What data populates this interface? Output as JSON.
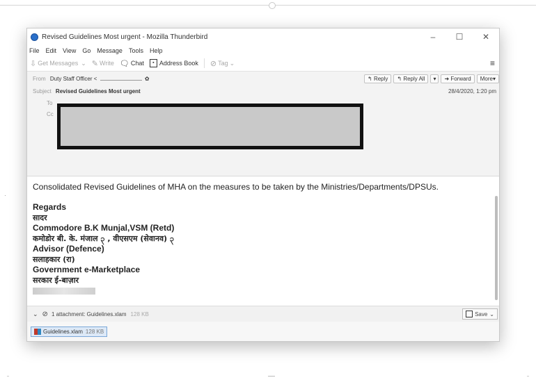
{
  "window": {
    "title": "Revised Guidelines Most urgent - Mozilla Thunderbird",
    "controls": {
      "minimize": "–",
      "maximize": "☐",
      "close": "✕"
    }
  },
  "menu": [
    "File",
    "Edit",
    "View",
    "Go",
    "Message",
    "Tools",
    "Help"
  ],
  "toolbar": {
    "get_messages": "Get Messages",
    "write": "Write",
    "chat": "Chat",
    "address_book": "Address Book",
    "tag": "Tag"
  },
  "header": {
    "from_label": "From",
    "from_value": "Duty Staff Officer <",
    "subject_label": "Subject",
    "subject": "Revised Guidelines Most urgent",
    "to_label": "To",
    "cc_label": "Cc",
    "date": "28/4/2020, 1:20 pm",
    "buttons": {
      "reply": "Reply",
      "reply_all": "Reply All",
      "forward": "Forward",
      "more": "More"
    }
  },
  "body": {
    "intro": "Consolidated Revised Guidelines of MHA on the measures to be taken by the Ministries/Departments/DPSUs.",
    "signature": [
      {
        "text": "Regards",
        "style": "b"
      },
      {
        "text": "सादर",
        "style": "dev"
      },
      {
        "text": "Commodore B.K Munjal,VSM (Retd)",
        "style": "b"
      },
      {
        "text": "कमोडोर बी. के. मंजाल ၃ , वीएसएम (सेवानव) ၃",
        "style": "dev"
      },
      {
        "text": "Advisor (Defence)",
        "style": "b"
      },
      {
        "text": "सलाहकार (रा)",
        "style": "dev"
      },
      {
        "text": "Government e-Marketplace",
        "style": "b"
      },
      {
        "text": "सरकार ई-बाज़ार",
        "style": "dev"
      }
    ]
  },
  "attachments": {
    "summary": "1 attachment: Guidelines.xlam",
    "size": "128 KB",
    "save": "Save",
    "chip_name": "Guidelines.xlam",
    "chip_size": "128 KB"
  },
  "icons": {
    "app": "thunderbird-icon",
    "accent": "#2a6fc9"
  }
}
